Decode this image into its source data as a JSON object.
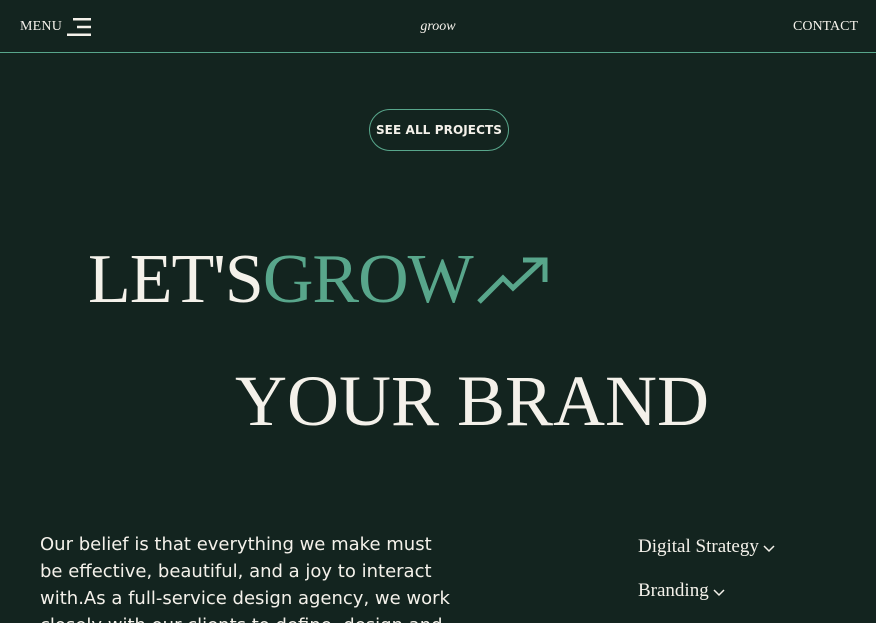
{
  "header": {
    "menu_label": "MENU",
    "logo": "groow",
    "contact_label": "CONTACT"
  },
  "hero": {
    "projects_button": "SEE ALL PROJECTS",
    "headline_part1": "LET'S",
    "headline_part2": "GROW",
    "headline_line2": "YOUR BRAND",
    "headline_icon": "trending-up-arrow-icon"
  },
  "about": {
    "text": "Our belief is that everything we make must be effective, beautiful, and a joy to interact with.As a full-service design agency, we work closely with our clients to define, design and"
  },
  "services": [
    {
      "label": "Digital Strategy",
      "icon": "chevron-down-icon"
    },
    {
      "label": "Branding",
      "icon": "chevron-down-icon"
    }
  ],
  "colors": {
    "background": "#13241f",
    "accent": "#58a68b",
    "text": "#f4f1ea"
  }
}
